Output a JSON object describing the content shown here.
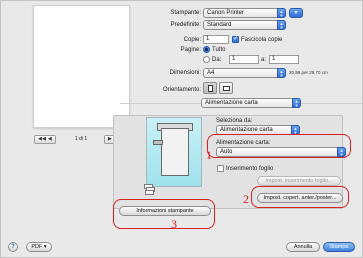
{
  "preview": {
    "first_btn": "◀◀ ◀",
    "next_btn": "▶ ▶▶",
    "page_count": "1 di 1"
  },
  "form": {
    "printer_label": "Stampante:",
    "printer_value": "Canon Printer",
    "preset_label": "Predefinite:",
    "preset_value": "Standard",
    "copies_label": "Copie:",
    "copies_value": "1",
    "collate_label": "Fascicola copie",
    "pages_label": "Pagine:",
    "pages_all": "Tutto",
    "pages_from": "Da:",
    "pages_from_value": "1",
    "pages_to": "a:",
    "pages_to_value": "1",
    "size_label": "Dimensioni:",
    "size_value": "A4",
    "size_dims": "20,99 per 29,70 cm",
    "orientation_label": "Orientamento:",
    "section_value": "Alimentazione carta"
  },
  "panel": {
    "select_from_label": "Seleziona da:",
    "select_from_value": "Alimentazione carta",
    "feed_label": "Alimentazione carta:",
    "feed_value": "Auto",
    "insert_sheet_label": "Inserimento foglio",
    "insert_settings_btn": "Impost. inserimento foglio...",
    "cover_settings_btn": "Impost. copert. anter./poster...",
    "printer_info_btn": "Informazioni stampante"
  },
  "annotations": {
    "n1": "1",
    "n2": "2",
    "n3": "3"
  },
  "footer": {
    "help": "?",
    "pdf": "PDF ▾",
    "cancel": "Annulla",
    "print": "Stampa"
  },
  "colors": {
    "accent": "#3e7fe0",
    "annotation_red": "#d62020",
    "printer_bg": "#b4e9f1"
  }
}
